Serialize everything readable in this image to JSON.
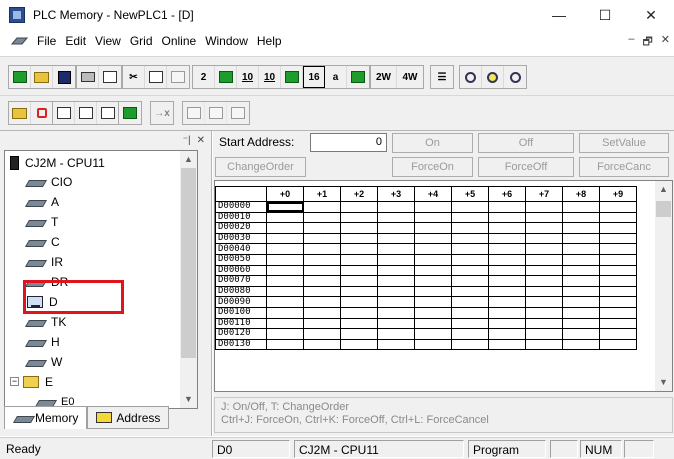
{
  "window": {
    "title": "PLC Memory - NewPLC1 - [D]",
    "minimize": "—",
    "maximize": "☐",
    "close": "✕"
  },
  "menu": {
    "items": [
      "File",
      "Edit",
      "View",
      "Grid",
      "Online",
      "Window",
      "Help"
    ],
    "mdi_minimize": "–",
    "mdi_restore": "🗗",
    "mdi_close": "✕"
  },
  "toolbar": {
    "format_buttons": [
      "2",
      "10",
      "10",
      "0.10",
      "16",
      "a",
      "",
      "2W",
      "4W"
    ]
  },
  "tree": {
    "root": "CJ2M - CPU11",
    "areas": [
      "CIO",
      "A",
      "T",
      "C",
      "IR",
      "DR",
      "D",
      "TK",
      "H",
      "W",
      "E",
      "E0"
    ]
  },
  "tabs": {
    "memory": "Memory",
    "address": "Address"
  },
  "controls": {
    "start_address_label": "Start Address:",
    "start_address_value": "0",
    "on": "On",
    "off": "Off",
    "set_value": "SetValue",
    "change_order": "ChangeOrder",
    "force_on": "ForceOn",
    "force_off": "ForceOff",
    "force_cancel": "ForceCanc"
  },
  "grid": {
    "columns": [
      "+0",
      "+1",
      "+2",
      "+3",
      "+4",
      "+5",
      "+6",
      "+7",
      "+8",
      "+9"
    ],
    "rows": [
      "D00000",
      "D00010",
      "D00020",
      "D00030",
      "D00040",
      "D00050",
      "D00060",
      "D00070",
      "D00080",
      "D00090",
      "D00100",
      "D00110",
      "D00120",
      "D00130"
    ]
  },
  "hints": {
    "line1": "J: On/Off,    T: ChangeOrder",
    "line2": "Ctrl+J: ForceOn,    Ctrl+K: ForceOff,    Ctrl+L: ForceCancel"
  },
  "status": {
    "ready": "Ready",
    "area": "D0",
    "plc": "CJ2M - CPU11",
    "mode": "Program",
    "num": "NUM"
  }
}
